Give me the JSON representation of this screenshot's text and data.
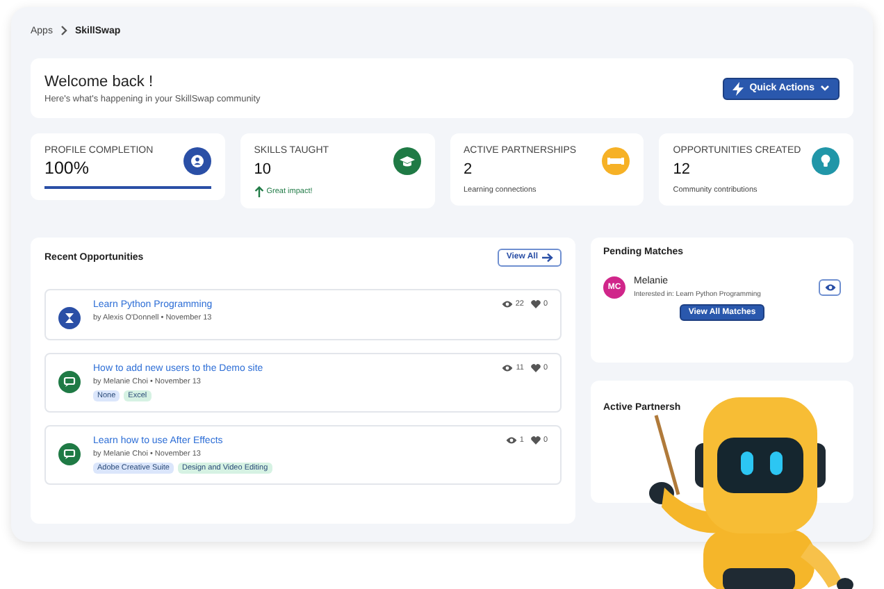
{
  "breadcrumb": [
    {
      "label": "Apps",
      "current": false
    },
    {
      "label": "SkillSwap",
      "current": true
    }
  ],
  "welcome": {
    "title": "Welcome back !",
    "subtitle": "Here's what's happening in your SkillSwap community",
    "action": "Quick Actions"
  },
  "stats": [
    {
      "kind": "progress",
      "label": "PROFILE COMPLETION",
      "value": "100%",
      "level": 1,
      "color": "#2a4fa6"
    },
    {
      "kind": "trend",
      "label": "SKILLS TAUGHT",
      "value": "10",
      "note": "Great impact!",
      "color": "#1f7a45"
    },
    {
      "kind": "note",
      "label": "ACTIVE PARTNERSHIPS",
      "value": "2",
      "note": "Learning connections",
      "color": "#f6b126"
    },
    {
      "kind": "note",
      "label": "OPPORTUNITIES CREATED",
      "value": "12",
      "note": "Community contributions",
      "color": "#2196a8"
    }
  ],
  "recent": {
    "title": "Recent Opportunities",
    "view_all": "View All",
    "items": [
      {
        "title": "Learn Python Programming",
        "meta": "by Alexis O'Donnell • November 13",
        "views": "22",
        "likes": "0",
        "color": "#2a4fa6"
      },
      {
        "title": "How to add new users to the Demo site",
        "meta": "by Melanie Choi • November 13",
        "views": "11",
        "likes": "0",
        "color": "#1f7a45",
        "tags": [
          {
            "label": "None",
            "color": "#dbe6fb"
          },
          {
            "label": "Excel",
            "color": "#d6f2e3"
          }
        ]
      },
      {
        "title": "Learn how to use After Effects",
        "meta": "by Melanie Choi • November 13",
        "views": "1",
        "likes": "0",
        "color": "#1f7a45",
        "tags": [
          {
            "label": "Adobe Creative Suite",
            "color": "#dbe6fb"
          },
          {
            "label": "Design and Video Editing",
            "color": "#d6f2e3"
          }
        ]
      }
    ]
  },
  "pending": {
    "title": "Pending Matches",
    "matches": [
      {
        "initials": "MC",
        "name": "Melanie",
        "detail": "Interested in: Learn Python Programming"
      }
    ],
    "button": "View All Matches"
  },
  "active": {
    "title": "Active Partnersh"
  }
}
